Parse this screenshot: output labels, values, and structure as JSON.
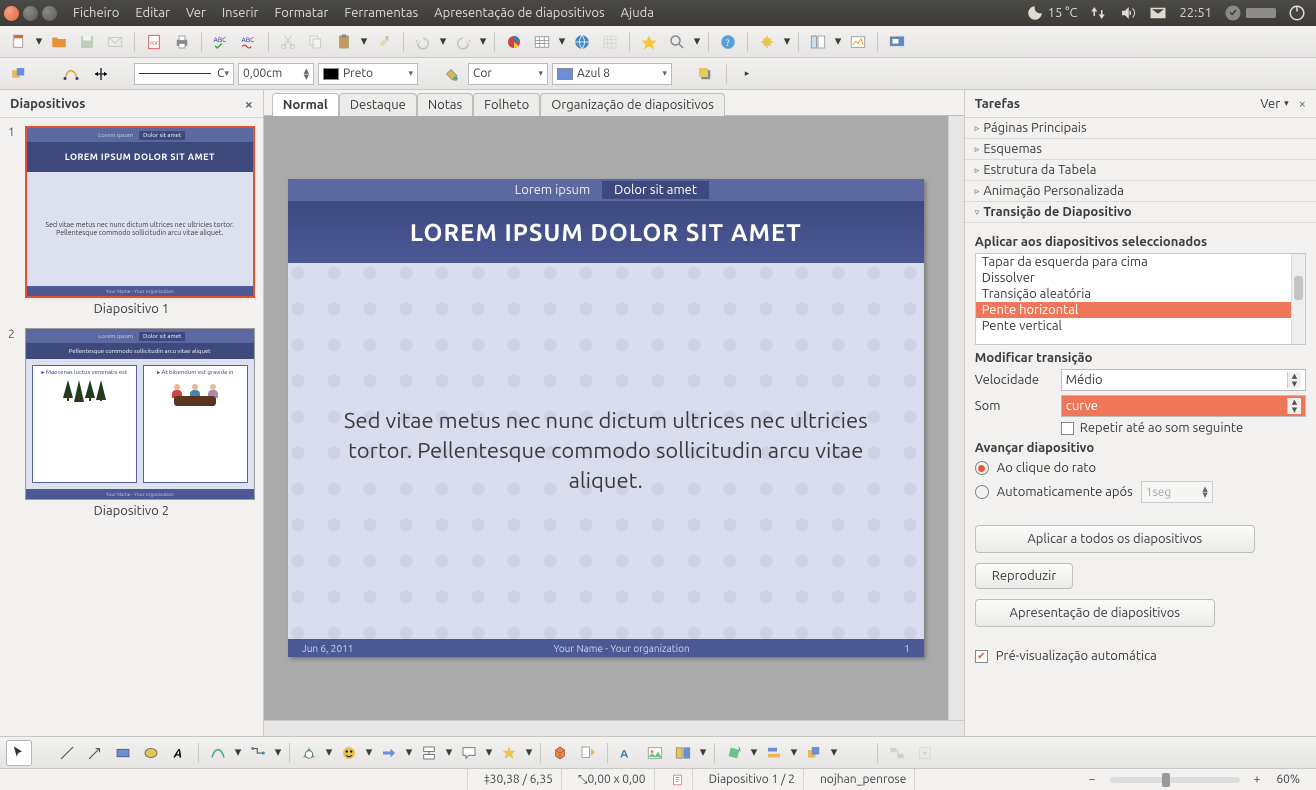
{
  "menubar": {
    "items": [
      "Ficheiro",
      "Editar",
      "Ver",
      "Inserir",
      "Formatar",
      "Ferramentas",
      "Apresentação de diapositivos",
      "Ajuda"
    ],
    "temperature": "15 °C",
    "time": "22:51"
  },
  "line_toolbar": {
    "style_label": "C",
    "width": "0,00cm",
    "line_color": "Preto",
    "line_color_hex": "#000000",
    "fill_mode": "Cor",
    "fill_color": "Azul 8",
    "fill_color_hex": "#6a8fd8"
  },
  "slides_panel": {
    "title": "Diapositivos",
    "labels": [
      "Diapositivo 1",
      "Diapositivo 2"
    ],
    "slide1": {
      "tab_off": "Lorem ipsum",
      "tab_on": "Dolor sit amet",
      "title": "LOREM IPSUM DOLOR SIT AMET",
      "body": "Sed vitae metus nec nunc dictum ultrices nec ultricies tortor. Pellentesque commodo sollicitudin arcu vitae aliquet.",
      "footer": "Your Name - Your organization"
    },
    "slide2": {
      "title": "Pellentesque commodo sollicitudin arcu vitae aliquet",
      "box1": "Maecenas luctus venenatis est",
      "box2": "At bibendum est gravida in",
      "footer": "Your Name - Your organization"
    }
  },
  "view_tabs": [
    "Normal",
    "Destaque",
    "Notas",
    "Folheto",
    "Organização de diapositivos"
  ],
  "view_active": 0,
  "canvas": {
    "tab_off": "Lorem ipsum",
    "tab_on": "Dolor sit amet",
    "title": "LOREM IPSUM DOLOR SIT AMET",
    "body": "Sed vitae metus nec nunc dictum ultrices nec ultricies tortor. Pellentesque commodo sollicitudin arcu vitae aliquet.",
    "footer_date": "Jun 6, 2011",
    "footer_mid": "Your Name - Your organization",
    "footer_num": "1"
  },
  "tasks": {
    "title": "Tarefas",
    "view_label": "Ver",
    "sections": [
      "Páginas Principais",
      "Esquemas",
      "Estrutura da Tabela",
      "Animação Personalizada",
      "Transição de Diapositivo"
    ],
    "open_section": 4,
    "apply_label": "Aplicar aos diapositivos seleccionados",
    "transitions": [
      "Tapar da esquerda para cima",
      "Dissolver",
      "Transição aleatória",
      "Pente horizontal",
      "Pente vertical"
    ],
    "selected_transition": 3,
    "modify_label": "Modificar transição",
    "speed_label": "Velocidade",
    "speed_value": "Médio",
    "sound_label": "Som",
    "sound_value": "curve",
    "repeat_label": "Repetir até ao som seguinte",
    "advance_label": "Avançar diapositivo",
    "advance_click": "Ao clique do rato",
    "advance_auto": "Automaticamente após",
    "auto_time": "1seg",
    "btn_apply_all": "Aplicar a todos os diapositivos",
    "btn_play": "Reproduzir",
    "btn_present": "Apresentação de diapositivos",
    "preview_label": "Pré-visualização automática"
  },
  "statusbar": {
    "coords": "30,38 / 6,35",
    "size": "0,00 x 0,00",
    "slide_info": "Diapositivo 1 / 2",
    "template": "nojhan_penrose",
    "zoom": "60%"
  }
}
